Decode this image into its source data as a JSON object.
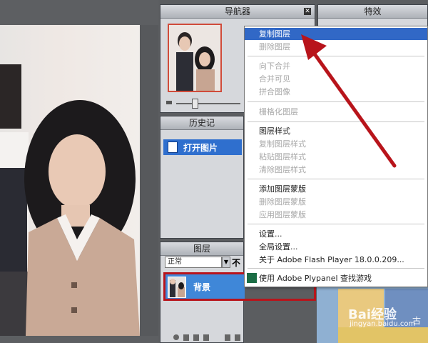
{
  "navigator": {
    "title": "导航器"
  },
  "effects": {
    "title": "特效"
  },
  "history": {
    "title": "历史记",
    "item": "打开图片"
  },
  "layers": {
    "title": "图层",
    "blend_mode": "正常",
    "opacity_label": "不",
    "layer_name": "背景"
  },
  "context_menu": {
    "items": [
      {
        "label": "复制图层",
        "state": "selected"
      },
      {
        "label": "删除图层",
        "state": "disabled"
      },
      {
        "label": "向下合并",
        "state": "disabled"
      },
      {
        "label": "合并可见",
        "state": "disabled"
      },
      {
        "label": "拼合图像",
        "state": "disabled"
      },
      {
        "label": "栅格化图层",
        "state": "disabled"
      },
      {
        "label": "图层样式",
        "state": "enabled"
      },
      {
        "label": "复制图层样式",
        "state": "disabled"
      },
      {
        "label": "粘贴图层样式",
        "state": "disabled"
      },
      {
        "label": "清除图层样式",
        "state": "disabled"
      },
      {
        "label": "添加图层蒙版",
        "state": "enabled"
      },
      {
        "label": "删除图层蒙版",
        "state": "disabled"
      },
      {
        "label": "应用图层蒙版",
        "state": "disabled"
      },
      {
        "label": "设置...",
        "state": "enabled"
      },
      {
        "label": "全局设置...",
        "state": "enabled"
      },
      {
        "label": "关于 Adobe Flash Player 18.0.0.209...",
        "state": "enabled"
      },
      {
        "label": "使用 Adobe Pl",
        "state": "enabled"
      },
      {
        "label": "ypanel 查找游戏",
        "state": "enabled"
      }
    ]
  },
  "watermark": {
    "text": "Bai",
    "suffix": "经验",
    "url": "jingyan.baidu.com"
  },
  "right_panel": {
    "label": "古"
  },
  "colors": {
    "highlight": "#3168c6",
    "annotation": "#b8141b"
  }
}
